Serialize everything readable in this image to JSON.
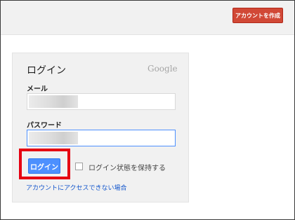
{
  "header": {
    "create_account_label": "アカウントを作成"
  },
  "login_card": {
    "title": "ログイン",
    "brand": "Google",
    "email_label": "メール",
    "password_label": "パスワード",
    "login_button": "ログイン",
    "stay_signed_in_label": "ログイン状態を保持する",
    "stay_signed_in_checked": false,
    "cant_access_link": "アカウントにアクセスできない場合"
  },
  "colors": {
    "create_button": "#d14836",
    "login_button": "#4d90fe",
    "highlight": "#e60012",
    "link": "#1155cc"
  }
}
